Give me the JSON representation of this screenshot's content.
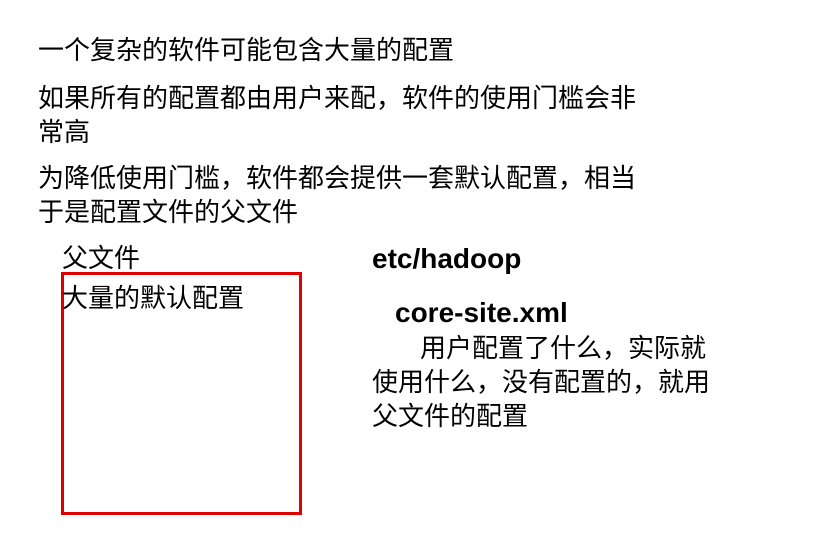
{
  "intro_lines": [
    "一个复杂的软件可能包含大量的配置",
    "如果所有的配置都由用户来配，软件的使用门槛会非",
    "常高",
    "为降低使用门槛，软件都会提供一套默认配置，相当",
    "于是配置文件的父文件"
  ],
  "left_panel": {
    "parent_file_label": "父文件",
    "default_config_label": "大量的默认配置",
    "box_color": "#e00000"
  },
  "right_panel": {
    "path": "etc/hadoop",
    "file": "core-site.xml",
    "note_lines": [
      "用户配置了什么，实际就",
      "使用什么，没有配置的，就用",
      "父文件的配置"
    ]
  }
}
